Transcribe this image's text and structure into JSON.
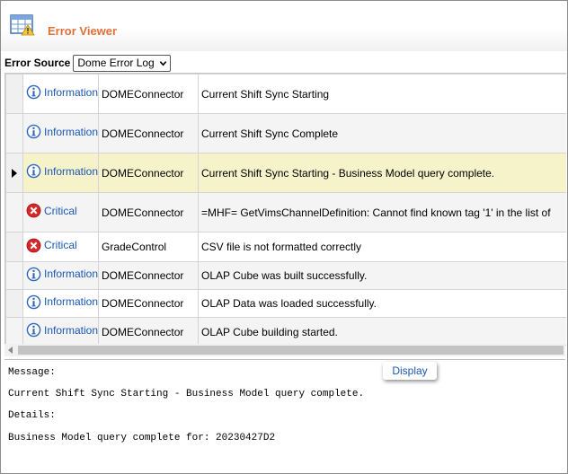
{
  "header": {
    "title": "Error Viewer",
    "icon": "table-warning-icon"
  },
  "source": {
    "label": "Error Source",
    "selected": "Dome Error Log"
  },
  "colors": {
    "title": "#e0703a",
    "link": "#1a57b5",
    "selected_row": "#f6f2ca"
  },
  "rows": [
    {
      "severity": "Information",
      "source": "DOMEConnector",
      "message": "Current Shift Sync Starting",
      "icon": "info-icon"
    },
    {
      "severity": "Information",
      "source": "DOMEConnector",
      "message": "Current Shift Sync Complete",
      "icon": "info-icon"
    },
    {
      "severity": "Information",
      "source": "DOMEConnector",
      "message": "Current Shift Sync Starting - Business Model query complete.",
      "icon": "info-icon",
      "selected": true
    },
    {
      "severity": "Critical",
      "source": "DOMEConnector",
      "message": "=MHF= GetVimsChannelDefinition: Cannot find known tag '1' in the list of",
      "icon": "critical-icon"
    },
    {
      "severity": "Critical",
      "source": "GradeControl",
      "message": "CSV file is not formatted correctly",
      "icon": "critical-icon"
    },
    {
      "severity": "Information",
      "source": "DOMEConnector",
      "message": "OLAP Cube was built successfully.",
      "icon": "info-icon"
    },
    {
      "severity": "Information",
      "source": "DOMEConnector",
      "message": "OLAP Data was loaded successfully.",
      "icon": "info-icon"
    },
    {
      "severity": "Information",
      "source": "DOMEConnector",
      "message": "OLAP Cube building started.",
      "icon": "info-icon"
    }
  ],
  "details": {
    "message_label": "Message:",
    "message_text": "Current Shift Sync Starting - Business Model query complete.",
    "details_label": "Details:",
    "details_text": "Business Model query complete for: 20230427D2",
    "display_button": "Display"
  }
}
